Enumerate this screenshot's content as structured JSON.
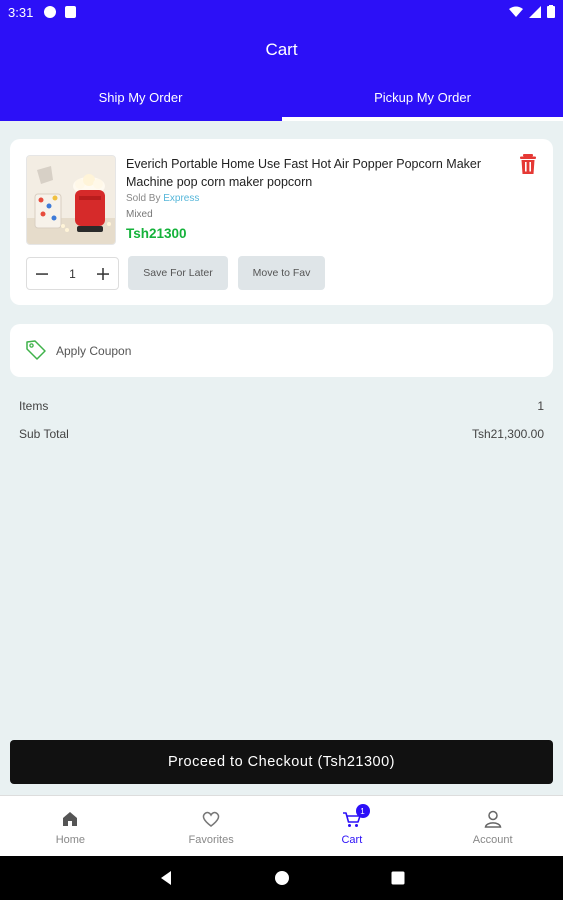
{
  "status_bar": {
    "time": "3:31"
  },
  "header": {
    "title": "Cart",
    "tabs": [
      {
        "label": "Ship My Order",
        "active": false
      },
      {
        "label": "Pickup My Order",
        "active": true
      }
    ]
  },
  "cart_item": {
    "name": "Everich Portable Home Use Fast Hot Air Popper Popcorn Maker Machine pop corn maker popcorn",
    "sold_by_label": "Sold By",
    "seller": "Express",
    "variant": "Mixed",
    "price": "Tsh21300",
    "quantity": "1",
    "save_later_label": "Save For Later",
    "move_fav_label": "Move to Fav"
  },
  "coupon": {
    "label": "Apply Coupon"
  },
  "summary": {
    "items_label": "Items",
    "items_value": "1",
    "subtotal_label": "Sub Total",
    "subtotal_value": "Tsh21,300.00"
  },
  "checkout": {
    "label": "Proceed to Checkout (Tsh21300)"
  },
  "bottom_nav": {
    "items": [
      {
        "label": "Home",
        "icon": "home-icon"
      },
      {
        "label": "Favorites",
        "icon": "heart-icon"
      },
      {
        "label": "Cart",
        "icon": "cart-icon",
        "badge": "1",
        "active": true
      },
      {
        "label": "Account",
        "icon": "account-icon"
      }
    ]
  },
  "colors": {
    "primary": "#2c10f7",
    "price": "#14b23a",
    "seller_link": "#55b6d9",
    "delete": "#e53935"
  }
}
